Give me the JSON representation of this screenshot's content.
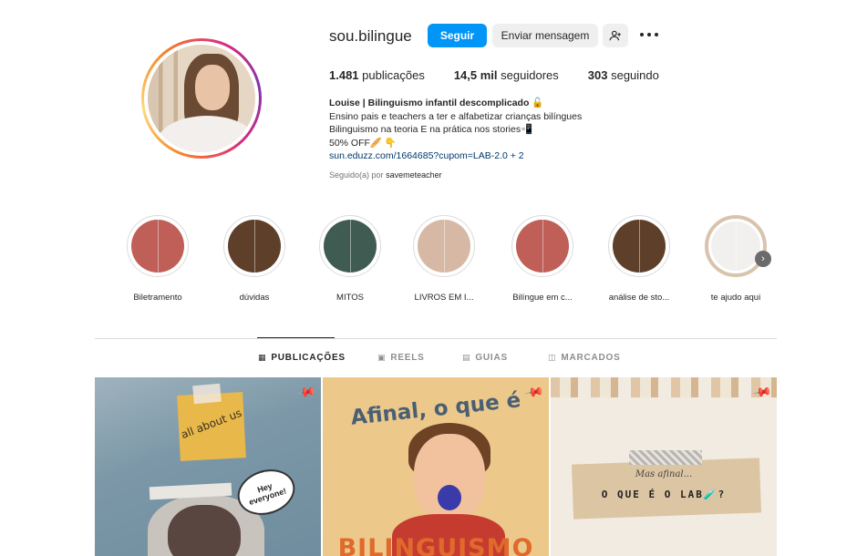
{
  "profile": {
    "username": "sou.bilingue",
    "follow_label": "Seguir",
    "message_label": "Enviar mensagem",
    "suggest_icon": "add-person-icon",
    "more_icon": "more-options-icon"
  },
  "stats": {
    "posts_count": "1.481",
    "posts_label": "publicações",
    "followers_count": "14,5 mil",
    "followers_label": "seguidores",
    "following_count": "303",
    "following_label": "seguindo"
  },
  "bio": {
    "name": "Louise | Bilinguismo infantil descomplicado 🔓",
    "line1": "Ensino pais e teachers a ter e alfabetizar crianças bilíngues",
    "line2": "Bilinguismo na teoria E na prática nos stories📲",
    "line3": "50% OFF🥖 👇",
    "link": "sun.eduzz.com/1664685?cupom=LAB-2.0 + 2",
    "followed_prefix": "Seguido(a) por",
    "followed_by": "savemeteacher"
  },
  "highlights": [
    {
      "label": "Biletramento",
      "color": "#bf5f57"
    },
    {
      "label": "dúvidas",
      "color": "#5e3f29"
    },
    {
      "label": "MITOS",
      "color": "#3f5b52"
    },
    {
      "label": "LIVROS EM I...",
      "color": "#d6b8a4"
    },
    {
      "label": "Bilíngue em c...",
      "color": "#bf5f57"
    },
    {
      "label": "análise de sto...",
      "color": "#5e3f29"
    },
    {
      "label": "te ajudo aqui",
      "color": "#f2f0ee"
    }
  ],
  "highlight_next_icon": "chevron-right-icon",
  "tabs": [
    {
      "label": "PUBLICAÇÕES",
      "icon": "grid-icon",
      "active": true
    },
    {
      "label": "REELS",
      "icon": "reels-icon",
      "active": false
    },
    {
      "label": "GUIAS",
      "icon": "guides-icon",
      "active": false
    },
    {
      "label": "MARCADOS",
      "icon": "tagged-icon",
      "active": false
    }
  ],
  "posts": [
    {
      "text1": "all about us",
      "text2": "Hey everyone!",
      "pinned": true
    },
    {
      "text1": "Afinal, o que é",
      "text2": "BILINGUISMO",
      "pinned": true
    },
    {
      "text1": "Mas afinal...",
      "text2": "O QUE É O LAB🧪?",
      "pinned": true
    }
  ]
}
